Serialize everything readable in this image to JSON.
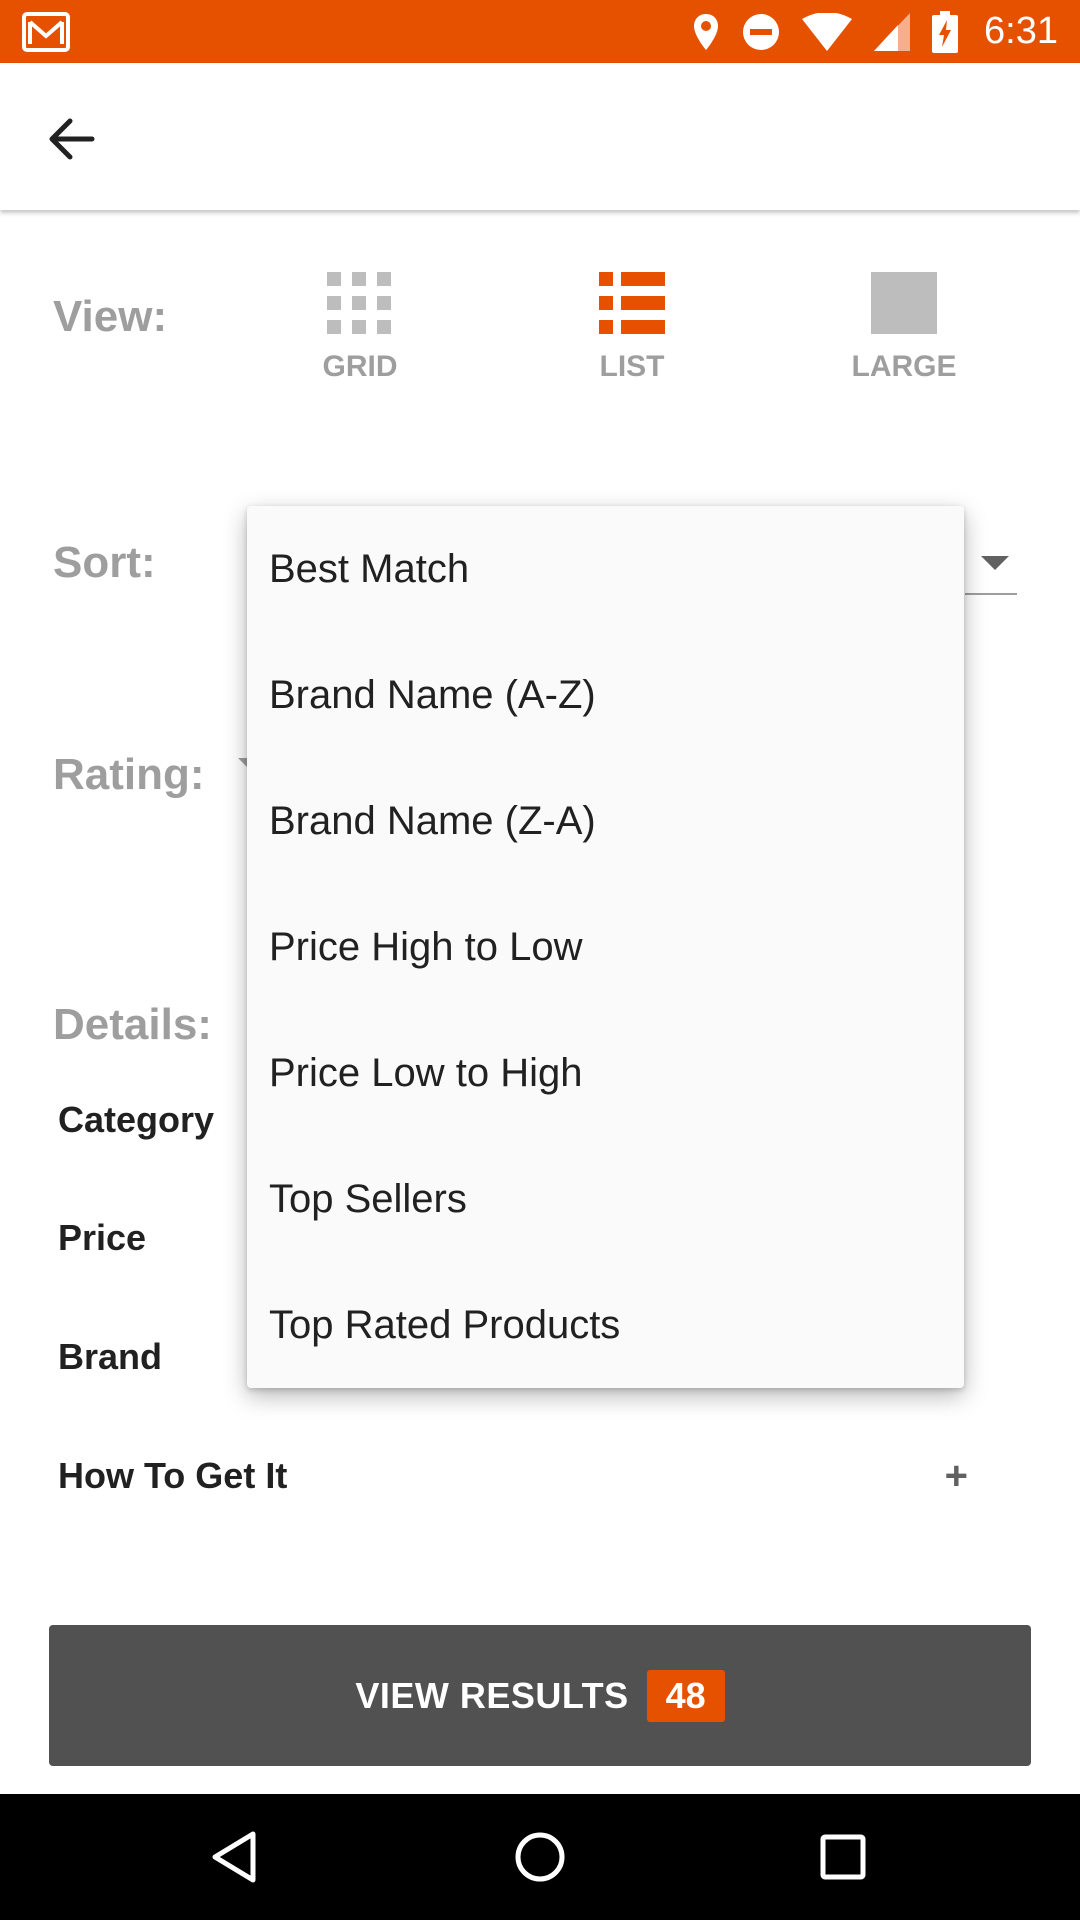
{
  "status_bar": {
    "time": "6:31",
    "icons": [
      "gmail-icon",
      "location-icon",
      "do-not-disturb-icon",
      "wifi-icon",
      "signal-icon",
      "battery-charging-icon"
    ],
    "background": "#e65100"
  },
  "app_bar": {
    "back_icon": "arrow-back-icon"
  },
  "view": {
    "label": "View:",
    "options": [
      {
        "label": "GRID",
        "icon": "grid-icon",
        "selected": false
      },
      {
        "label": "LIST",
        "icon": "list-icon",
        "selected": true
      },
      {
        "label": "LARGE",
        "icon": "large-icon",
        "selected": false
      }
    ]
  },
  "sort": {
    "label": "Sort:",
    "menu_items": [
      "Best Match",
      "Brand Name (A-Z)",
      "Brand Name (Z-A)",
      "Price High to Low",
      "Price Low to High",
      "Top Sellers",
      "Top Rated Products"
    ]
  },
  "rating": {
    "label": "Rating:"
  },
  "details": {
    "label": "Details:",
    "rows": [
      {
        "label": "Category"
      },
      {
        "label": "Price"
      },
      {
        "label": "Brand"
      },
      {
        "label": "How To Get It",
        "icon": "+"
      }
    ]
  },
  "view_results": {
    "label": "VIEW RESULTS",
    "count": "48"
  },
  "colors": {
    "accent": "#e65100",
    "inactive": "#9e9e9e",
    "button": "#515151"
  },
  "nav_bar": {
    "buttons": [
      "back-triangle-icon",
      "home-circle-icon",
      "recents-square-icon"
    ]
  }
}
